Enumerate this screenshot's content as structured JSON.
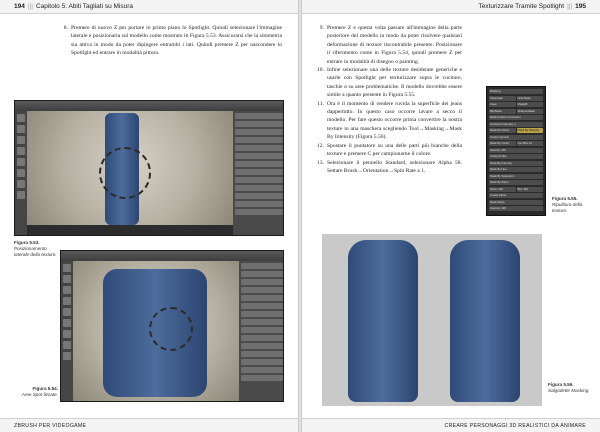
{
  "left_page": {
    "header": {
      "page_number": "194",
      "chapter": "Capitolo 5: Abiti Tagliati su Misura"
    },
    "footer": "ZBrush per Videogame",
    "paragraph": {
      "number": "8.",
      "text": "Premere di nuovo Z per portare in primo piano lo Spotlight. Quindi selezionare l'immagine laterale e posizionarla sul modello come mostrato in Figura 5.53. Assicurarsi che la simmetria sia attiva in modo da poter dipingere entrambi i lati. Quindi premere Z per nascondere lo Spotlight ed entrare in modalità pittura."
    },
    "figures": [
      {
        "label": "Figura 5.53.",
        "caption": "Posizionamento laterale della texture."
      },
      {
        "label": "Figura 5.54.",
        "caption": "Aree Spot-lizzate."
      }
    ]
  },
  "right_page": {
    "header": {
      "chapter": "Texturizzare Tramite Spotlight",
      "page_number": "195"
    },
    "footer": "Creare Personaggi 3D Realistici da Animare",
    "paragraphs": [
      {
        "number": "9.",
        "text": "Premere Z e questa volta passare all'immagine della parte posteriore del modello in modo da poter risolvere qualsiasi deformazione di texture riscontrabile presente. Posizionare il riferimento come in Figura 5.54, quindi premere Z per entrare in modalità di disegno o painting."
      },
      {
        "number": "10.",
        "text": "Infine selezionare una delle texture desiderate generiche e usarle con Spotlight per texturizzare sopra le cuciture, taschie o su aree problematiche. Il modello dovrebbe essere simile a quanto presente in Figura 5.55."
      },
      {
        "number": "11.",
        "text": "Ora è il momento di rendere ruvida la superficie dei jeans dappertutto. In questo caso occorre lavare a secco il modello. Per fare questo occorre prima convertire la nostra texture in una maschera scegliendo Tool→Masking→Mask By Intensity (Figura 5.56)."
      },
      {
        "number": "12.",
        "text": "Spostare il puntatore su una delle parti più bianche della texture e premere C per campionarne il colore."
      },
      {
        "number": "13.",
        "text": "Selezionare il pennello Standard, selezionare Alpha 58. Settare Brush→Orientation→Spin Rate a 1."
      }
    ],
    "panel_rows": [
      [
        "Masking"
      ],
      [
        "Viewmask",
        "Hide Mask"
      ],
      [
        "Clear",
        "MaskAll"
      ],
      [
        "BlurMask",
        "SharpenMask"
      ],
      [
        "Mask Ambient Occlusion"
      ],
      [
        "Occlusion Intensity 1"
      ],
      [
        "Mask By Cavity",
        "Mask By Intensity"
      ],
      [
        "Cavity Intensity"
      ],
      [
        "Mask By Cavity",
        "Cav Blur 12"
      ],
      [
        "Intensity 100"
      ],
      [
        "Cavity Profile"
      ],
      [
        "Mask By Intensity"
      ],
      [
        "Mask By Hue"
      ],
      [
        "Mask By Saturation"
      ],
      [
        "Mask By Alpha"
      ],
      [
        "Intens 100",
        "Blur 100"
      ],
      [
        "Create Alpha"
      ],
      [
        "Mask Alpha"
      ],
      [
        "Intensity 100"
      ]
    ],
    "figures": [
      {
        "label": "Figura 5.55.",
        "caption": "Ripulitura della texture."
      },
      {
        "label": "Figura 5.56.",
        "caption": "Salgodette Masking."
      }
    ]
  },
  "colors": {
    "page": "#ffffff",
    "header_bg": "#f4f4f4",
    "zbrush_ui": "#3a3a3a",
    "denim": "#3d5b8a",
    "render_bg": "#c9c9c9"
  }
}
